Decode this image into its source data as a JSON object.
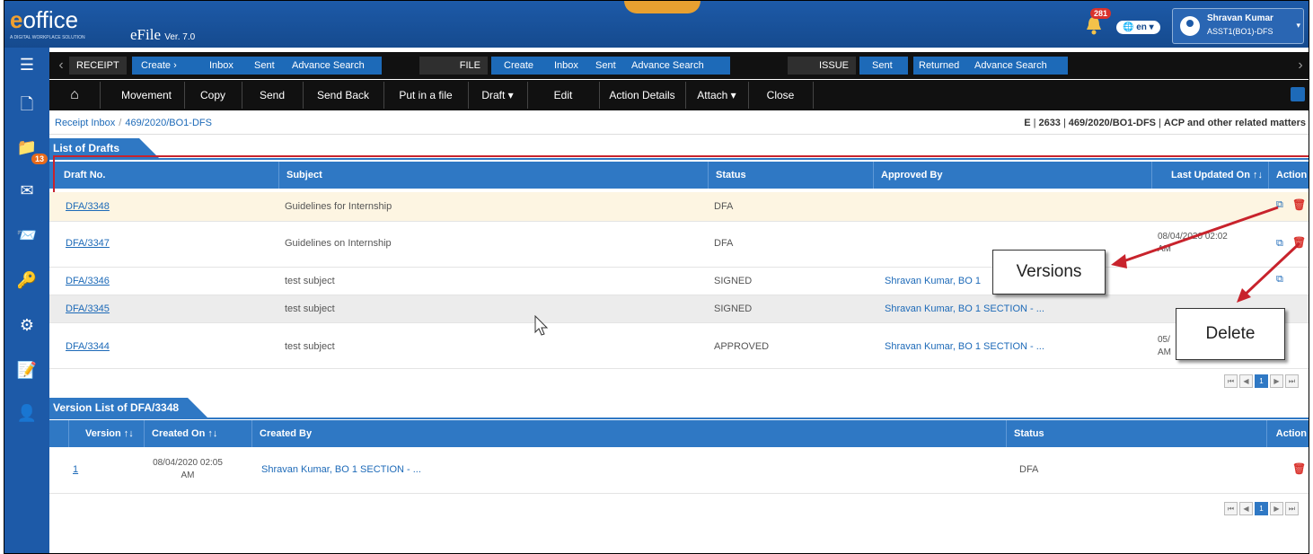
{
  "header": {
    "logo_e": "e",
    "logo_rest": "office",
    "logo_tagline": "A DIGITAL WORKPLACE SOLUTION",
    "app_name": "eFile",
    "version": "Ver. 7.0",
    "notification_count": "281",
    "language": "en",
    "user_name": "Shravan Kumar",
    "user_role": "ASST1(BO1)-DFS"
  },
  "sidebar": {
    "file_badge": "13"
  },
  "navbar": {
    "receipt": {
      "label": "RECEIPT",
      "links": [
        "Create",
        "Inbox",
        "Sent",
        "Advance Search"
      ]
    },
    "file": {
      "label": "FILE",
      "links": [
        "Create",
        "Inbox",
        "Sent",
        "Advance Search"
      ]
    },
    "issue": {
      "label": "ISSUE",
      "links": [
        "Sent",
        "Returned",
        "Advance Search"
      ]
    }
  },
  "toolbar": {
    "buttons": [
      "Movement",
      "Copy",
      "Send",
      "Send Back",
      "Put in a file",
      "Draft ▾",
      "Edit",
      "Action Details",
      "Attach ▾",
      "Close"
    ]
  },
  "breadcrumb": {
    "root": "Receipt Inbox",
    "current": "469/2020/BO1-DFS"
  },
  "receipt_info": {
    "type": "E",
    "number": "2633",
    "receipt_no": "469/2020/BO1-DFS",
    "subject": "ACP and other related matters"
  },
  "drafts": {
    "title": "List of Drafts",
    "columns": [
      "Draft No.",
      "Subject",
      "Status",
      "Approved By",
      "Last Updated On ↑↓",
      "Action"
    ],
    "rows": [
      {
        "no": "DFA/3348",
        "subject": "Guidelines for Internship",
        "status": "DFA",
        "approved_by": "",
        "updated": ""
      },
      {
        "no": "DFA/3347",
        "subject": "Guidelines on Internship",
        "status": "DFA",
        "approved_by": "",
        "updated": "08/04/2020 02:02 AM"
      },
      {
        "no": "DFA/3346",
        "subject": "test subject",
        "status": "SIGNED",
        "approved_by": "Shravan Kumar, BO 1",
        "updated": ""
      },
      {
        "no": "DFA/3345",
        "subject": "test subject",
        "status": "SIGNED",
        "approved_by": "Shravan Kumar, BO 1 SECTION - ...",
        "updated": ""
      },
      {
        "no": "DFA/3344",
        "subject": "test subject",
        "status": "APPROVED",
        "approved_by": "Shravan Kumar, BO 1 SECTION - ...",
        "updated": "05/ AM"
      }
    ],
    "page": "1"
  },
  "versions": {
    "title": "Version List of DFA/3348",
    "columns": [
      "Version ↑↓",
      "Created On ↑↓",
      "Created By",
      "Status",
      "Action"
    ],
    "rows": [
      {
        "version": "1",
        "created_on": "08/04/2020 02:05 AM",
        "created_by": "Shravan Kumar, BO 1 SECTION - ...",
        "status": "DFA"
      }
    ],
    "page": "1"
  },
  "callouts": {
    "versions": "Versions",
    "delete": "Delete"
  }
}
